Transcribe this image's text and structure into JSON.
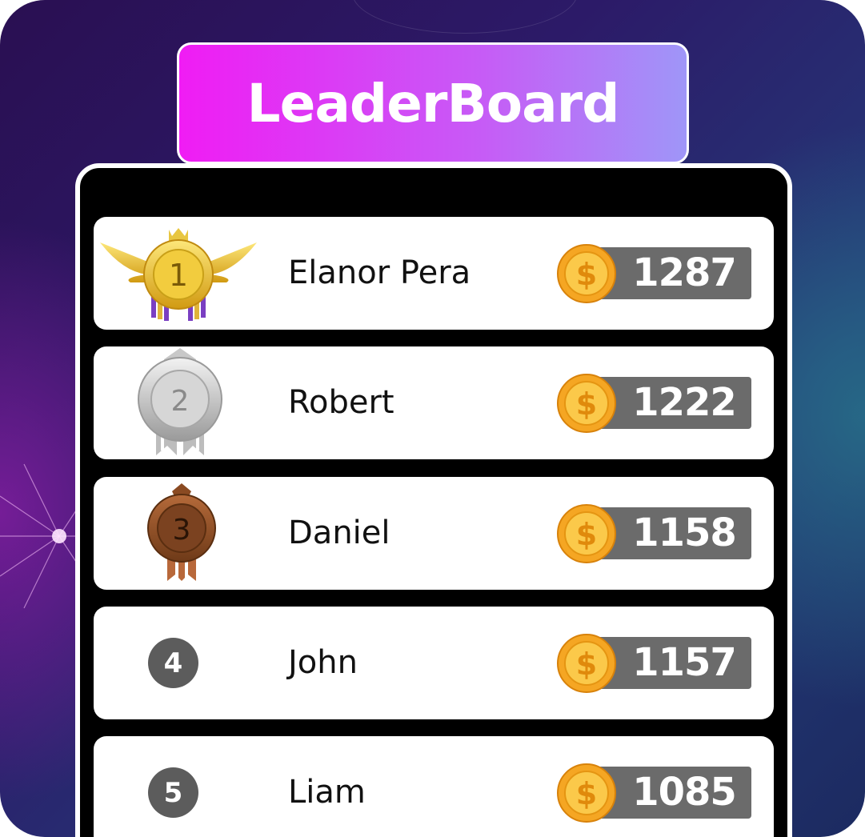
{
  "header": {
    "title": "LeaderBoard"
  },
  "colors": {
    "title_gradient_start": "#f01cf4",
    "title_gradient_end": "#9f96f8",
    "board_background": "#000000",
    "row_background": "#ffffff",
    "score_pill": "#6b6b6b",
    "coin_gold": "#f5a623",
    "rank_circle": "#5c5c5c"
  },
  "leaderboard": {
    "entries": [
      {
        "rank": "1",
        "name": "Elanor Pera",
        "score": "1287",
        "badge": "gold-winged-medal-icon"
      },
      {
        "rank": "2",
        "name": "Robert",
        "score": "1222",
        "badge": "silver-medal-icon"
      },
      {
        "rank": "3",
        "name": "Daniel",
        "score": "1158",
        "badge": "bronze-medal-icon"
      },
      {
        "rank": "4",
        "name": "John",
        "score": "1157",
        "badge": "rank-circle"
      },
      {
        "rank": "5",
        "name": "Liam",
        "score": "1085",
        "badge": "rank-circle"
      }
    ],
    "score_icon": "coin-dollar-icon"
  }
}
